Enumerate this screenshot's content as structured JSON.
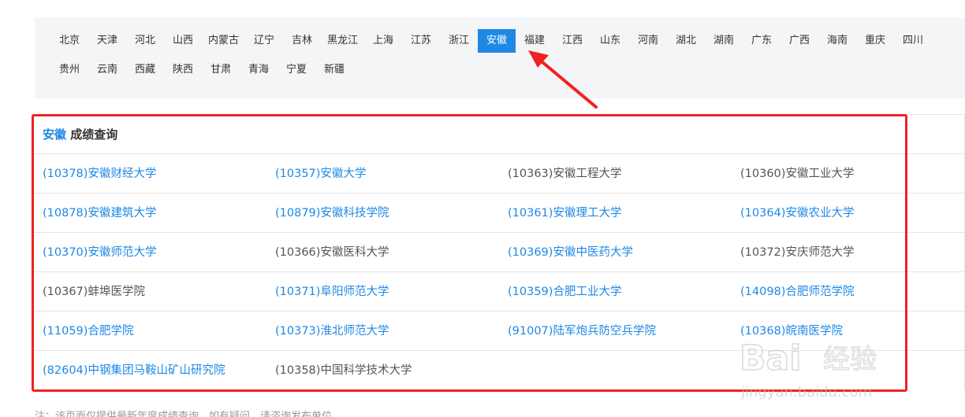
{
  "provinces_row1": [
    "北京",
    "天津",
    "河北",
    "山西",
    "内蒙古",
    "辽宁",
    "吉林",
    "黑龙江",
    "上海",
    "江苏",
    "浙江",
    "安徽",
    "福建",
    "江西",
    "山东",
    "河南",
    "湖北",
    "湖南",
    "广东",
    "广西",
    "海南",
    "重庆",
    "四川"
  ],
  "provinces_row2": [
    "贵州",
    "云南",
    "西藏",
    "陕西",
    "甘肃",
    "青海",
    "宁夏",
    "新疆"
  ],
  "active_province": "安徽",
  "header": {
    "province": "安徽",
    "title": "成绩查询"
  },
  "universities": [
    [
      {
        "name": "(10378)安徽财经大学",
        "link": true
      },
      {
        "name": "(10357)安徽大学",
        "link": true
      },
      {
        "name": "(10363)安徽工程大学",
        "link": false
      },
      {
        "name": "(10360)安徽工业大学",
        "link": false
      }
    ],
    [
      {
        "name": "(10878)安徽建筑大学",
        "link": true
      },
      {
        "name": "(10879)安徽科技学院",
        "link": true
      },
      {
        "name": "(10361)安徽理工大学",
        "link": true
      },
      {
        "name": "(10364)安徽农业大学",
        "link": true
      }
    ],
    [
      {
        "name": "(10370)安徽师范大学",
        "link": true
      },
      {
        "name": "(10366)安徽医科大学",
        "link": false
      },
      {
        "name": "(10369)安徽中医药大学",
        "link": true
      },
      {
        "name": "(10372)安庆师范大学",
        "link": false
      }
    ],
    [
      {
        "name": "(10367)蚌埠医学院",
        "link": false
      },
      {
        "name": "(10371)阜阳师范大学",
        "link": true
      },
      {
        "name": "(10359)合肥工业大学",
        "link": true
      },
      {
        "name": "(14098)合肥师范学院",
        "link": true
      }
    ],
    [
      {
        "name": "(11059)合肥学院",
        "link": true
      },
      {
        "name": "(10373)淮北师范大学",
        "link": true
      },
      {
        "name": "(91007)陆军炮兵防空兵学院",
        "link": true
      },
      {
        "name": "(10368)皖南医学院",
        "link": true
      }
    ],
    [
      {
        "name": "(82604)中钢集团马鞍山矿山研究院",
        "link": true
      },
      {
        "name": "(10358)中国科学技术大学",
        "link": false
      }
    ]
  ],
  "footer_note": "注：该页面仅提供最新年度成绩查询，如有疑问，请咨询发布单位。",
  "watermark": {
    "brand": "Bai",
    "brand_cn": "经验",
    "url": "jingyan.baidu.com"
  },
  "colors": {
    "accent": "#1e88e5",
    "annotation": "#ee2222",
    "panel_bg": "#f4f5f6"
  }
}
